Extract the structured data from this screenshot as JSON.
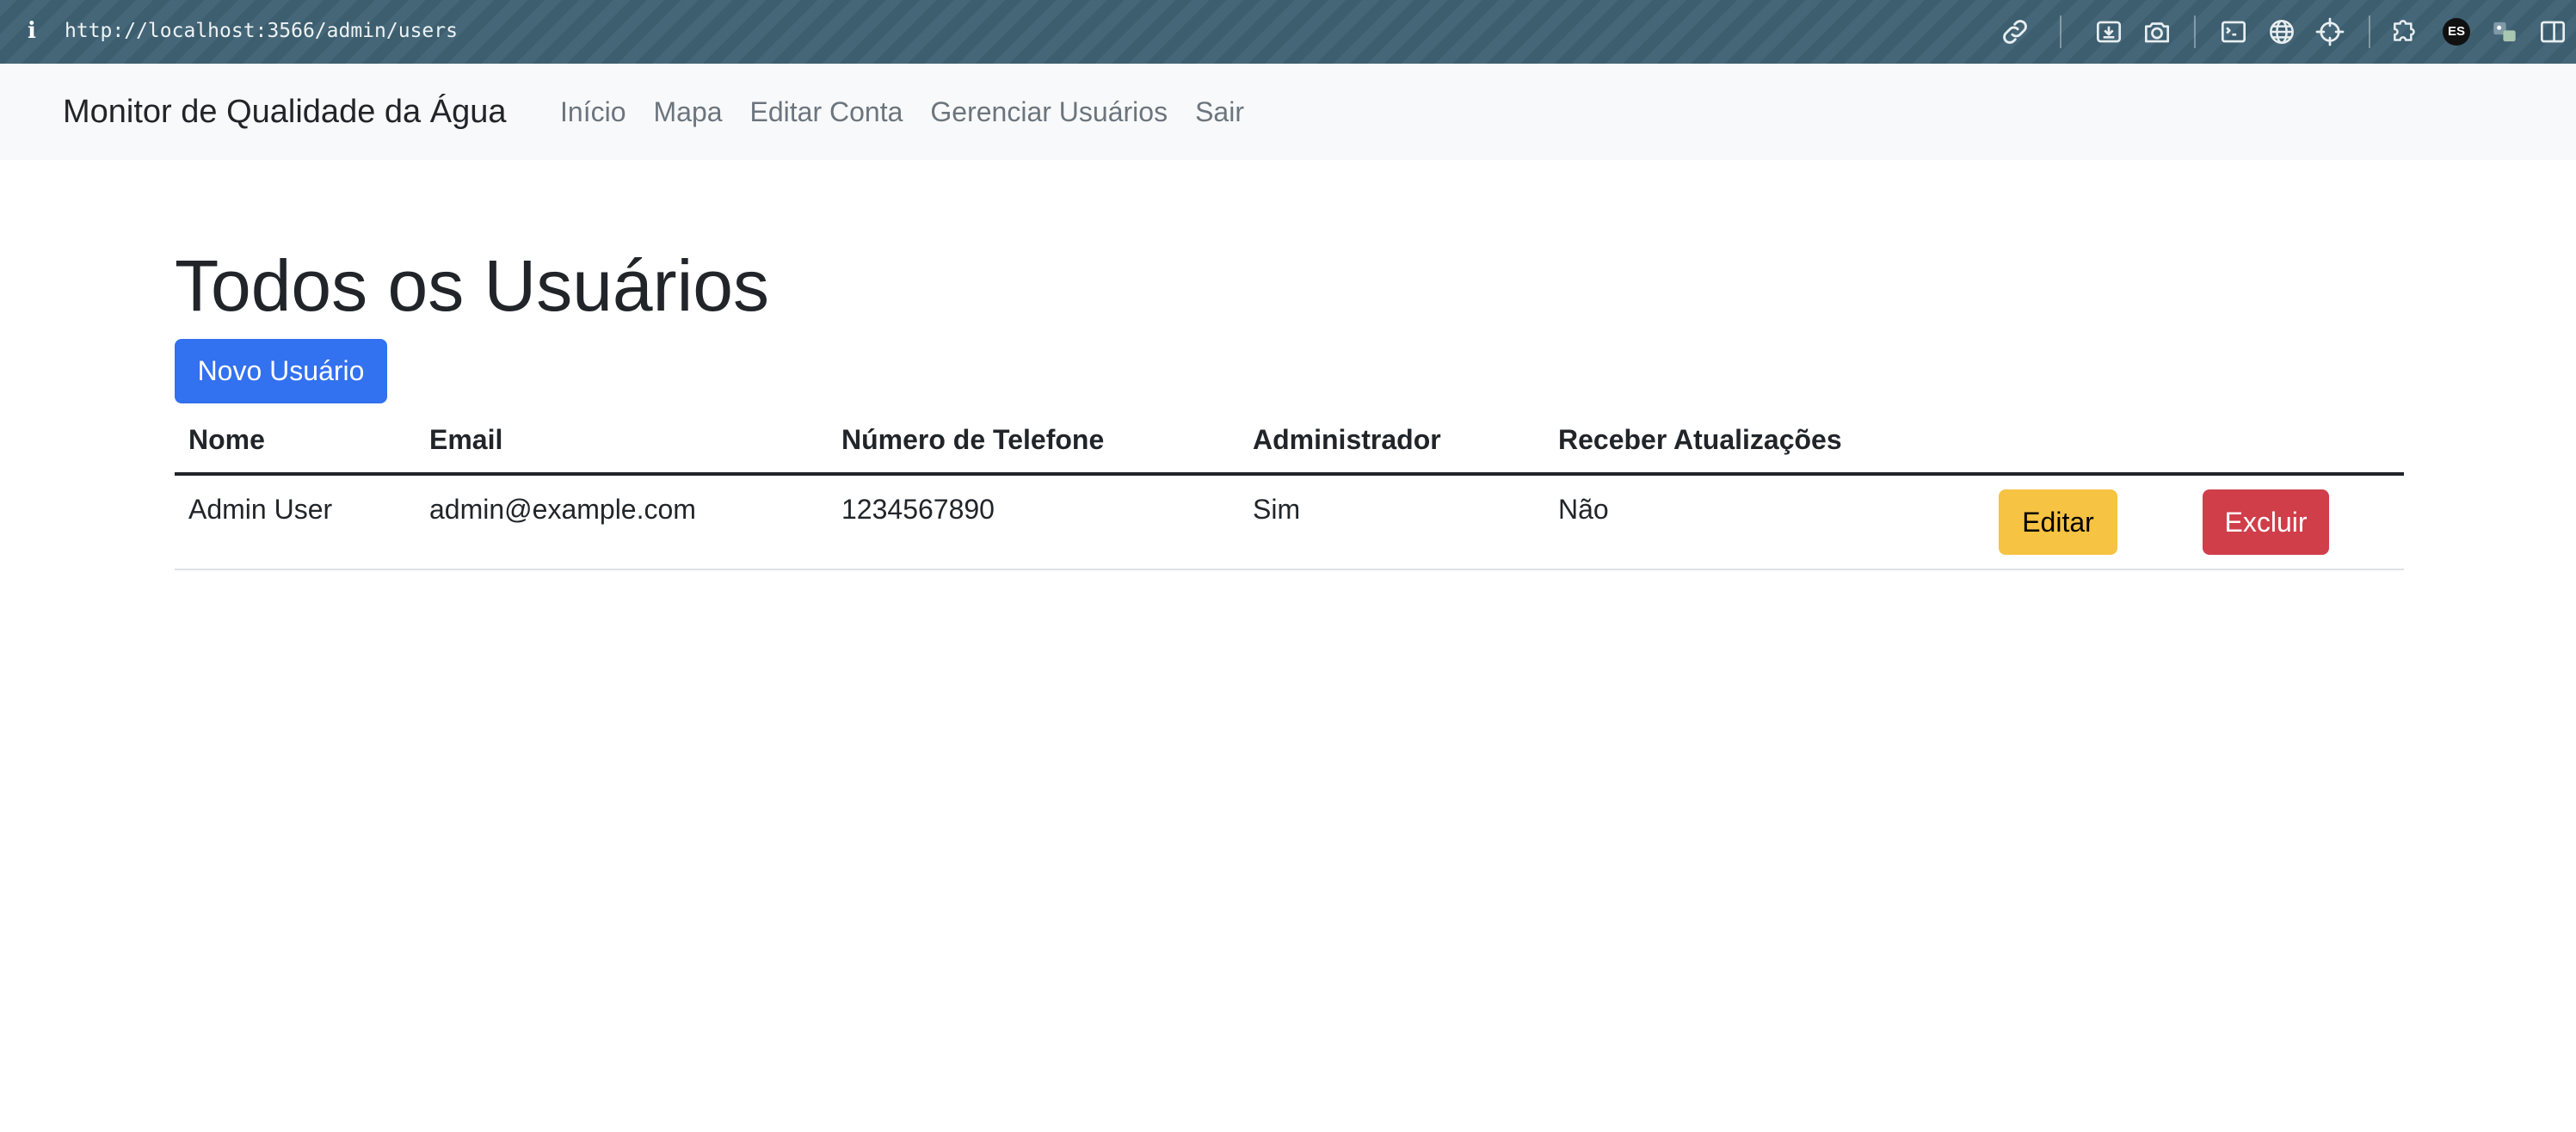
{
  "browser": {
    "info_icon": "info-icon",
    "url": "http://localhost:3566/admin/users",
    "avatar_initials": "ES"
  },
  "navbar": {
    "brand": "Monitor de Qualidade da Água",
    "links": [
      {
        "label": "Início"
      },
      {
        "label": "Mapa"
      },
      {
        "label": "Editar Conta"
      },
      {
        "label": "Gerenciar Usuários"
      },
      {
        "label": "Sair"
      }
    ]
  },
  "main": {
    "title": "Todos os Usuários",
    "new_user_button": "Novo Usuário",
    "table": {
      "columns": [
        "Nome",
        "Email",
        "Número de Telefone",
        "Administrador",
        "Receber Atualizações"
      ],
      "rows": [
        {
          "nome": "Admin User",
          "email": "admin@example.com",
          "telefone": "1234567890",
          "administrador": "Sim",
          "receber_atualizacoes": "Não",
          "edit_label": "Editar",
          "delete_label": "Excluir"
        }
      ]
    }
  },
  "colors": {
    "chrome_bg": "#3e6173",
    "navbar_bg": "#f8f9fa",
    "primary": "#3271f0",
    "warning": "#f6c343",
    "danger": "#d03e4a",
    "text": "#212529",
    "muted": "#6c757d"
  }
}
